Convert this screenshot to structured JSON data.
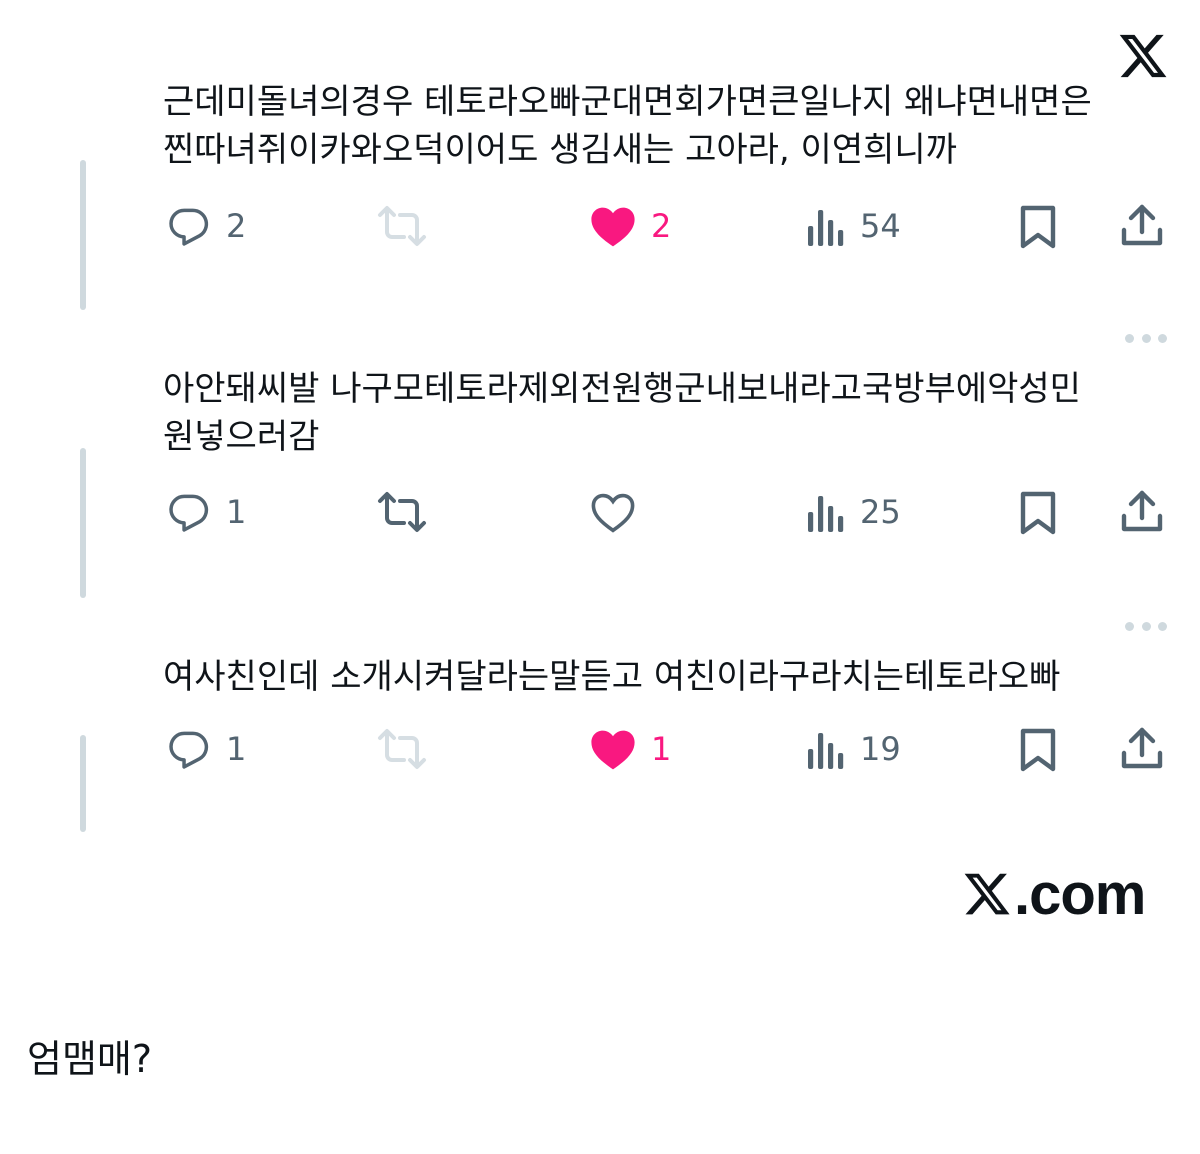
{
  "brand": {
    "logo": "x-logo-icon",
    "footer_domain": ".com"
  },
  "replies": [
    {
      "text": "근데미돌녀의경우 테토라오빠군대면회가면큰일나지 왜냐면내면은\n찐따녀쥐이카와오덕이어도 생김새는 고아라, 이연희니까",
      "reply_count": "2",
      "retweet_count": "",
      "retweet_disabled": true,
      "like_count": "2",
      "liked": true,
      "views": "54"
    },
    {
      "text": "아안돼씨발 나구모테토라제외전원행군내보내라고국방부에악성민\n원넣으러감",
      "reply_count": "1",
      "retweet_count": "",
      "retweet_disabled": false,
      "like_count": "",
      "liked": false,
      "views": "25"
    },
    {
      "text": "여사친인데 소개시켜달라는말듣고 여친이라구라치는테토라오빠",
      "reply_count": "1",
      "retweet_count": "",
      "retweet_disabled": true,
      "like_count": "1",
      "liked": true,
      "views": "19"
    }
  ],
  "icons": {
    "reply": "reply-icon",
    "retweet": "retweet-icon",
    "like": "heart-icon",
    "views": "views-icon",
    "bookmark": "bookmark-icon",
    "share": "share-icon",
    "more": "more-icon"
  },
  "colors": {
    "text": "#0f1419",
    "icon": "#536471",
    "like": "#f91880",
    "thread_line": "#cfd9de",
    "retweet_disabled": "#d6dee3"
  },
  "caption": "엄맴매?"
}
